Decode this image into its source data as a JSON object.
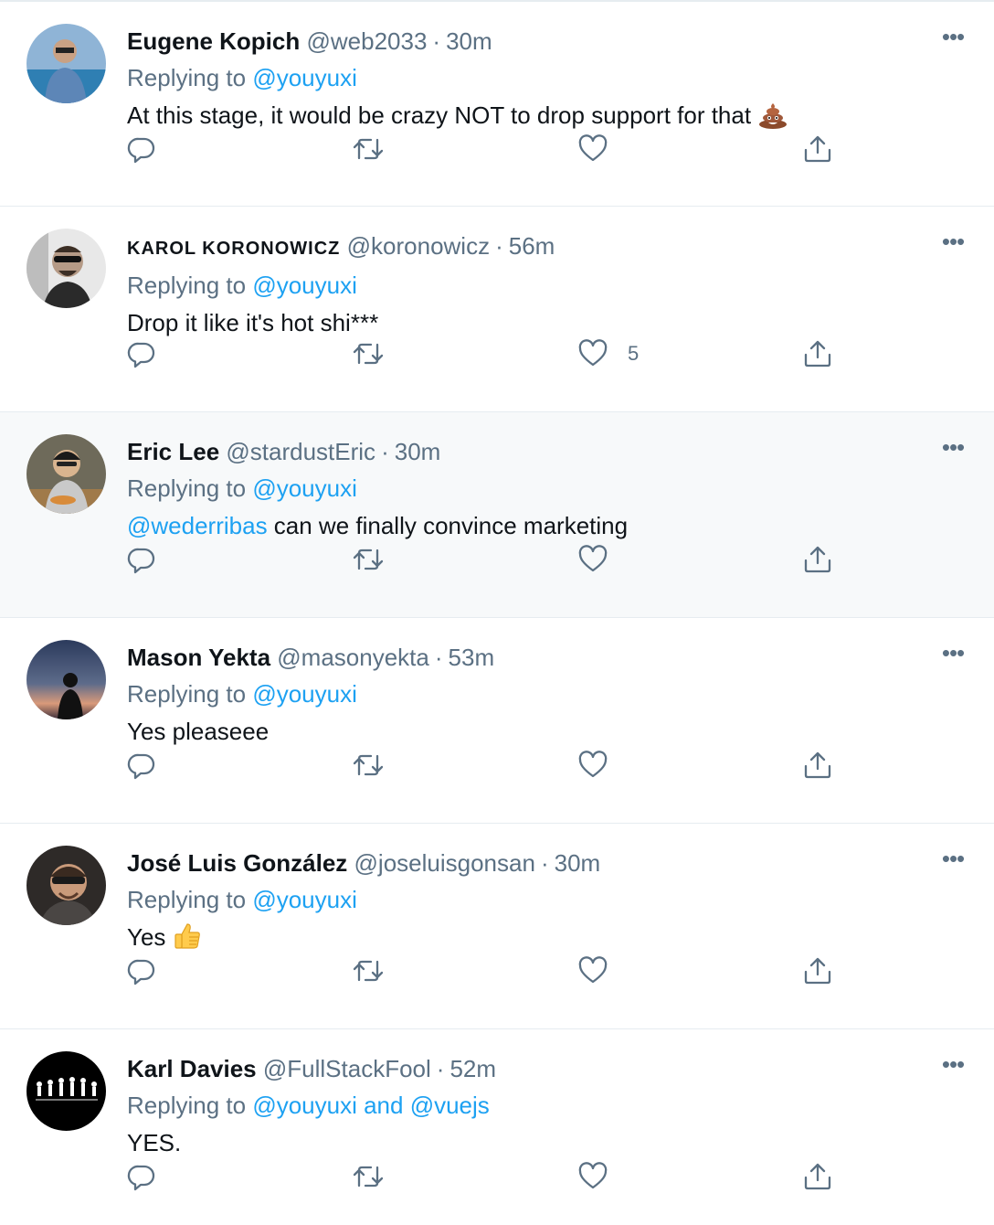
{
  "tweets": [
    {
      "name": "Eugene Kopich",
      "handle": "@web2033",
      "time": "30m",
      "replying_prefix": "Replying to",
      "replying_to": "@youyuxi",
      "text": "At this stage, it would be crazy NOT to drop support for that",
      "emoji": "pile-of-poo-emoji",
      "likes": ""
    },
    {
      "name": "KAROL KORONOWICZ",
      "handle": "@koronowicz",
      "time": "56m",
      "replying_prefix": "Replying to",
      "replying_to": "@youyuxi",
      "text": "Drop it like it's hot shi***",
      "likes": "5"
    },
    {
      "name": "Eric Lee",
      "handle": "@stardustEric",
      "time": "30m",
      "replying_prefix": "Replying to",
      "replying_to": "@youyuxi",
      "text_mention": "@wederribas",
      "text": " can we finally convince marketing",
      "likes": ""
    },
    {
      "name": "Mason Yekta",
      "handle": "@masonyekta",
      "time": "53m",
      "replying_prefix": "Replying to",
      "replying_to": "@youyuxi",
      "text": "Yes pleaseee",
      "likes": ""
    },
    {
      "name": "José Luis González",
      "handle": "@joseluisgonsan",
      "time": "30m",
      "replying_prefix": "Replying to",
      "replying_to": "@youyuxi",
      "text": "Yes",
      "emoji": "thumbs-up-emoji",
      "likes": ""
    },
    {
      "name": "Karl Davies",
      "handle": "@FullStackFool",
      "time": "52m",
      "replying_prefix": "Replying to",
      "replying_to": "@youyuxi and @vuejs",
      "text": "YES.",
      "likes": ""
    }
  ],
  "dot": "·",
  "more_glyph": "•••",
  "colors": {
    "accent": "#1da1f2",
    "secondary_text": "#5b7083",
    "primary_text": "#0f1419",
    "divider": "#e6ecf0"
  },
  "icons": {
    "reply": "reply-icon",
    "retweet": "retweet-icon",
    "like": "heart-icon",
    "share": "share-icon",
    "more": "more-icon"
  }
}
